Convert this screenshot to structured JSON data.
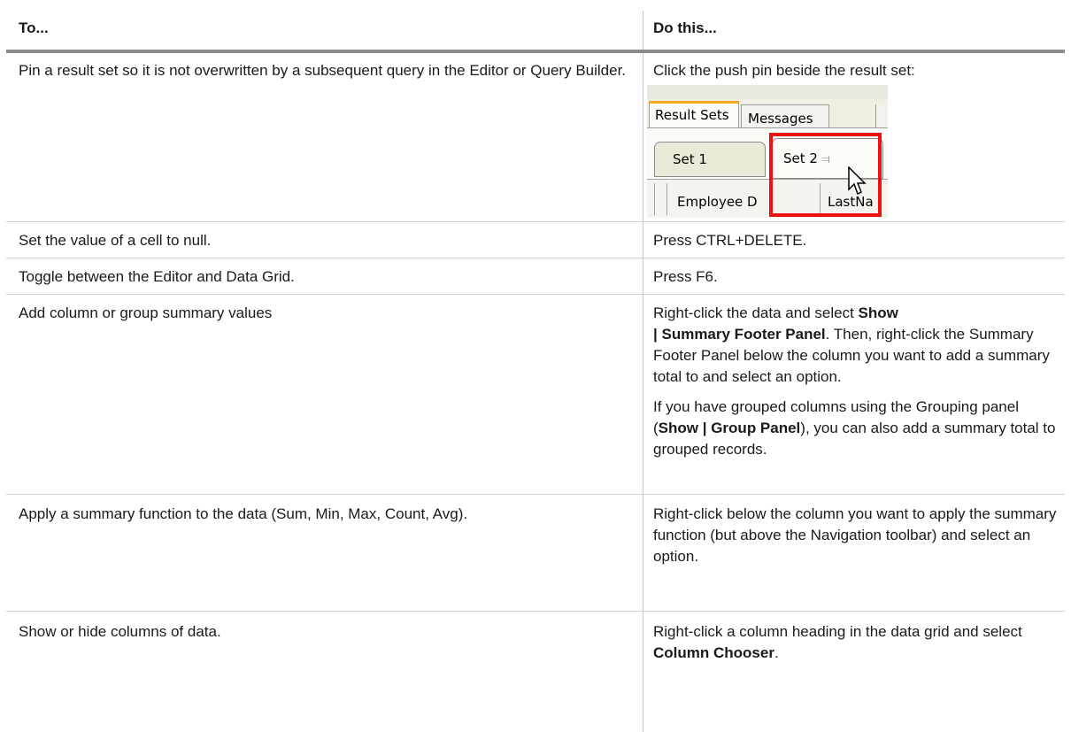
{
  "header": {
    "col1": "To...",
    "col2": "Do this..."
  },
  "rows": [
    {
      "to": "Pin a result set so it is not overwritten by a subsequent query in the Editor or Query Builder.",
      "do_text": "Click the push pin beside the result set:"
    },
    {
      "to": "Set the value of a cell to null.",
      "do_text": "Press CTRL+DELETE."
    },
    {
      "to": "Toggle between the Editor and Data Grid.",
      "do_text": "Press F6."
    },
    {
      "to": "Add column or group summary values",
      "p1_a": "Right-click the data and select ",
      "p1_b1": "Show",
      "p1_b2": "| Summary Footer Panel",
      "p1_c": ". Then, right-click the Summary Footer Panel below the column you want to add a summary total to and select an option.",
      "p2_a": "If you have grouped columns using the Grouping panel (",
      "p2_b": "Show | Group Panel",
      "p2_c": "), you can also add a summary total to grouped records."
    },
    {
      "to": "Apply a summary function to the data (Sum, Min, Max, Count, Avg).",
      "do_text": "Right-click below the column you want to apply the summary function (but above the Navigation toolbar) and select an option."
    },
    {
      "to": "Show or hide columns of data.",
      "do_a": "Right-click a column heading in the data grid and select ",
      "do_b": "Column Chooser",
      "do_c": "."
    }
  ],
  "screenshot": {
    "tab_result_sets": "Result Sets",
    "tab_messages": "Messages",
    "tab_set1": "Set 1",
    "tab_set2": "Set 2",
    "pin_icon": "push-pin-icon",
    "col_employee": "Employee D",
    "col_last": "LastNa",
    "highlight_color": "#ee1111"
  }
}
